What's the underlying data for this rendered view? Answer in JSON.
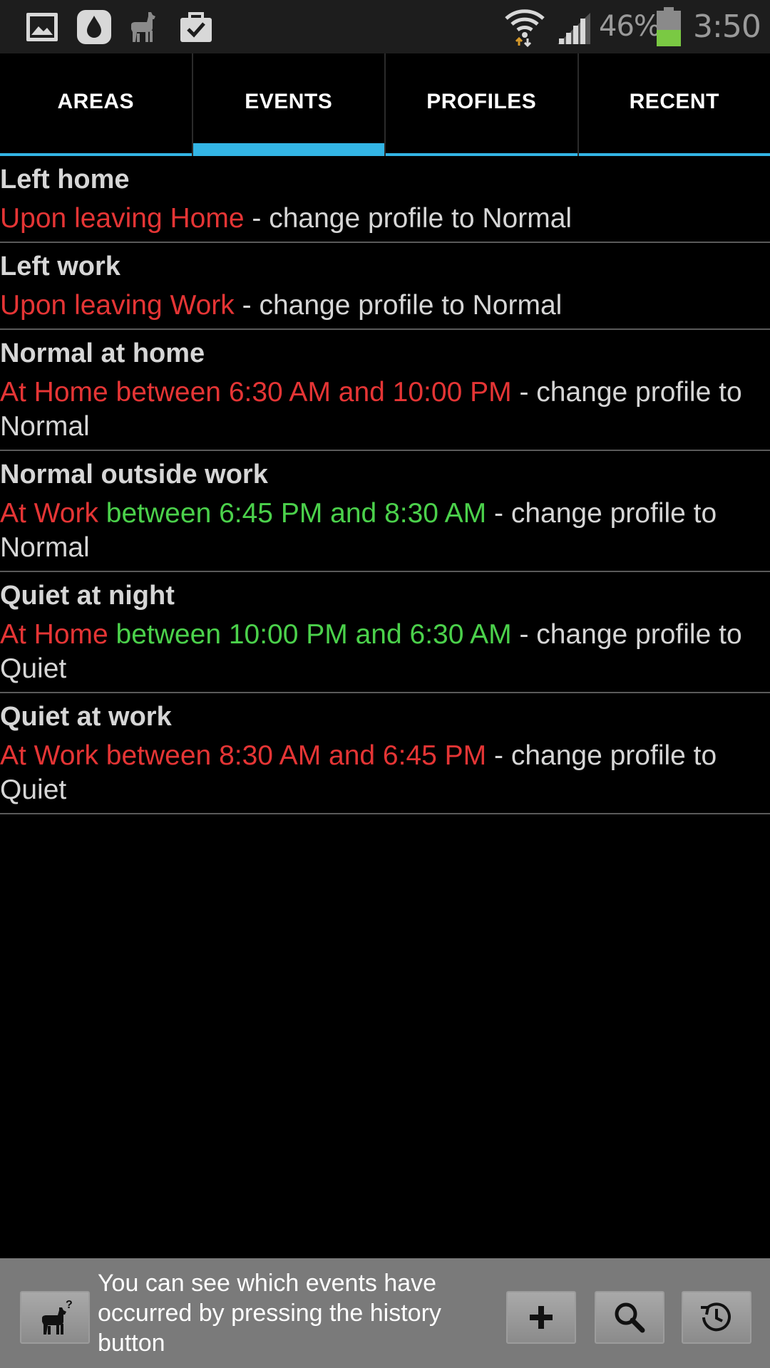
{
  "status_bar": {
    "battery_percent": "46%",
    "battery_level": 0.46,
    "time": "3:50",
    "notification_icons": [
      "gallery-icon",
      "drop-icon",
      "llama-icon",
      "task-icon"
    ],
    "colors": {
      "battery_fill": "#7ac943",
      "text": "#9a9a9a"
    }
  },
  "tabs": [
    {
      "label": "AREAS",
      "selected": false
    },
    {
      "label": "EVENTS",
      "selected": true
    },
    {
      "label": "PROFILES",
      "selected": false
    },
    {
      "label": "RECENT",
      "selected": false
    }
  ],
  "events": [
    {
      "title": "Left home",
      "segments": [
        {
          "text": "Upon leaving Home",
          "color": "red"
        },
        {
          "text": " - change profile to Normal",
          "color": "gray"
        }
      ]
    },
    {
      "title": "Left work",
      "segments": [
        {
          "text": "Upon leaving Work",
          "color": "red"
        },
        {
          "text": " - change profile to Normal",
          "color": "gray"
        }
      ]
    },
    {
      "title": "Normal at home",
      "segments": [
        {
          "text": "At Home between 6:30 AM and 10:00 PM",
          "color": "red"
        },
        {
          "text": " - change profile to Normal",
          "color": "gray"
        }
      ]
    },
    {
      "title": "Normal outside work",
      "segments": [
        {
          "text": "At Work",
          "color": "red"
        },
        {
          "text": " between 6:45 PM and 8:30 AM",
          "color": "green"
        },
        {
          "text": " - change profile to Normal",
          "color": "gray"
        }
      ]
    },
    {
      "title": "Quiet at night",
      "segments": [
        {
          "text": "At Home",
          "color": "red"
        },
        {
          "text": " between 10:00 PM and 6:30 AM",
          "color": "green"
        },
        {
          "text": " - change profile to Quiet",
          "color": "gray"
        }
      ]
    },
    {
      "title": "Quiet at work",
      "segments": [
        {
          "text": "At Work between 8:30 AM and 6:45 PM",
          "color": "red"
        },
        {
          "text": " - change profile to Quiet",
          "color": "gray"
        }
      ]
    }
  ],
  "bottom_bar": {
    "hint": "You can see which events have occurred by pressing the history button",
    "buttons": [
      "llama-menu-icon",
      "add-icon",
      "search-icon",
      "history-icon"
    ]
  },
  "colors": {
    "accent": "#33b5e5",
    "red": "#e53535",
    "green": "#4bd14b",
    "gray": "#d6d6d6"
  }
}
